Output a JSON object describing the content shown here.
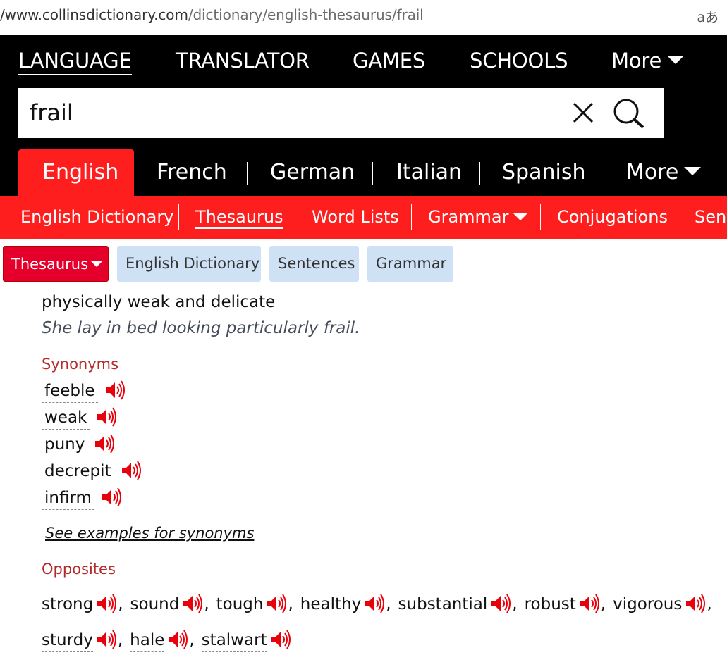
{
  "browser": {
    "url_domain": "/www.collinsdictionary.com",
    "url_path": "/dictionary/english-thesaurus/frail",
    "translate_icon": "aあ"
  },
  "topnav": {
    "items": [
      "LANGUAGE",
      "TRANSLATOR",
      "GAMES",
      "SCHOOLS",
      "More"
    ]
  },
  "search": {
    "value": "frail"
  },
  "languages": {
    "tabs": [
      "English",
      "French",
      "German",
      "Italian",
      "Spanish",
      "More"
    ]
  },
  "subnav": {
    "items": [
      "English Dictionary",
      "Thesaurus",
      "Word Lists",
      "Grammar",
      "Conjugations",
      "Sent"
    ]
  },
  "pills": [
    "Thesaurus",
    "English Dictionary",
    "Sentences",
    "Grammar"
  ],
  "entry": {
    "definition": "physically weak and delicate",
    "example": "She lay in bed looking particularly frail.",
    "synonyms_label": "Synonyms",
    "synonyms": [
      "feeble",
      "weak",
      "puny",
      "decrepit",
      "infirm"
    ],
    "see_examples": "See examples for synonyms",
    "opposites_label": "Opposites",
    "opposites_row1": [
      "strong",
      "sound",
      "tough",
      "healthy",
      "substantial",
      "robust",
      "vigorous"
    ],
    "opposites_row2": [
      "sturdy",
      "hale",
      "stalwart"
    ]
  },
  "colors": {
    "brand_red": "#ff1e1e",
    "pill_active": "#e5002b",
    "pill_plain": "#cfe2f5",
    "section_label": "#b22a2a"
  },
  "icons": {
    "clear": "close-icon",
    "search": "search-icon",
    "audio": "speaker-icon",
    "dropdown": "chevron-down-icon"
  }
}
